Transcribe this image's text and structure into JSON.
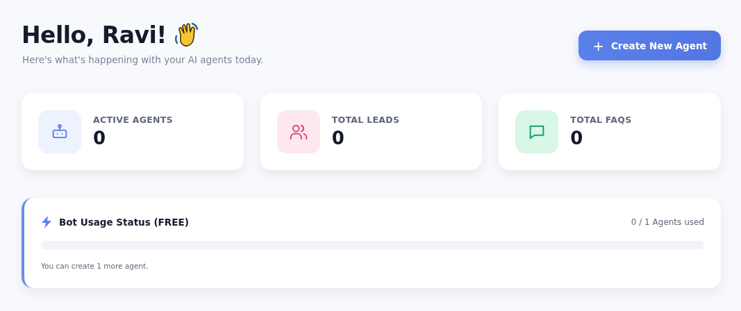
{
  "header": {
    "title": "Hello, Ravi!",
    "subtitle": "Here's what's happening with your AI agents today."
  },
  "create_button": {
    "icon": "+",
    "label": "Create New Agent"
  },
  "stats": [
    {
      "kind": "robot",
      "color": "#5b7be0",
      "label": "ACTIVE AGENTS",
      "value": "0"
    },
    {
      "kind": "users",
      "color": "#e0447c",
      "label": "TOTAL LEADS",
      "value": "0"
    },
    {
      "kind": "chat",
      "color": "#16a067",
      "label": "TOTAL FAQS",
      "value": "0"
    }
  ],
  "usage": {
    "title": "Bot Usage Status (FREE)",
    "reading": "0 / 1 Agents used",
    "level": 0,
    "note": "You can create 1 more agent."
  }
}
